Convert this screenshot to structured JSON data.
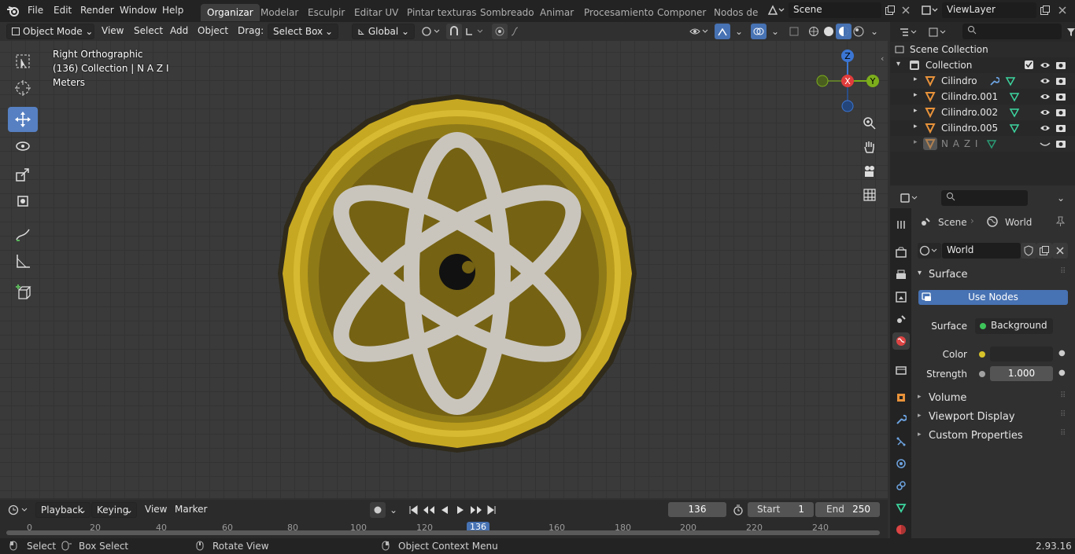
{
  "top_menu": {
    "logo": "blender-logo-icon",
    "items": [
      "File",
      "Edit",
      "Render",
      "Window",
      "Help"
    ]
  },
  "workspaces": {
    "tabs": [
      "Organizar",
      "Modelar",
      "Esculpir",
      "Editar UV",
      "Pintar texturas",
      "Sombreado",
      "Animar",
      "Procesamiento",
      "Componer",
      "Nodos de g"
    ],
    "active_index": 0
  },
  "scene_selector": {
    "value": "Scene"
  },
  "view_layer_selector": {
    "value": "ViewLayer"
  },
  "viewport_header": {
    "mode": "Object Mode",
    "menus": [
      "View",
      "Select",
      "Add",
      "Object"
    ],
    "drag_label": "Drag:",
    "drag_value": "Select Box",
    "orientation": "Global"
  },
  "viewport_overlay": {
    "line1": "Right Orthographic",
    "line2": "(136) Collection | N A Z I",
    "line3": "Meters"
  },
  "gizmo": {
    "x": "X",
    "y": "Y",
    "z": "Z"
  },
  "outliner": {
    "root": "Scene Collection",
    "collection": "Collection",
    "items": [
      {
        "name": "Cilindro"
      },
      {
        "name": "Cilindro.001"
      },
      {
        "name": "Cilindro.002"
      },
      {
        "name": "Cilindro.005"
      },
      {
        "name": "N A Z I"
      }
    ]
  },
  "properties": {
    "breadcrumb_scene": "Scene",
    "breadcrumb_world": "World",
    "world_name": "World",
    "surface_panel": "Surface",
    "use_nodes_label": "Use Nodes",
    "surface_label": "Surface",
    "surface_value": "Background",
    "color_label": "Color",
    "strength_label": "Strength",
    "strength_value": "1.000",
    "collapsed_panels": [
      "Volume",
      "Viewport Display",
      "Custom Properties"
    ]
  },
  "timeline": {
    "menus": [
      "Playback",
      "Keying",
      "View",
      "Marker"
    ],
    "current_frame": "136",
    "start_label": "Start",
    "start_value": "1",
    "end_label": "End",
    "end_value": "250",
    "ticks": [
      "0",
      "20",
      "40",
      "60",
      "80",
      "100",
      "120",
      "136",
      "160",
      "180",
      "200",
      "220",
      "240"
    ]
  },
  "statusbar": {
    "select": "Select",
    "box_select": "Box Select",
    "rotate_view": "Rotate View",
    "context_menu": "Object Context Menu",
    "version": "2.93.16"
  },
  "colors": {
    "accent": "#5680c2",
    "coin_gold": "#c7a822",
    "coin_inner": "#756213",
    "atom": "#c9c5bd",
    "active_frame": "#4772b3"
  }
}
